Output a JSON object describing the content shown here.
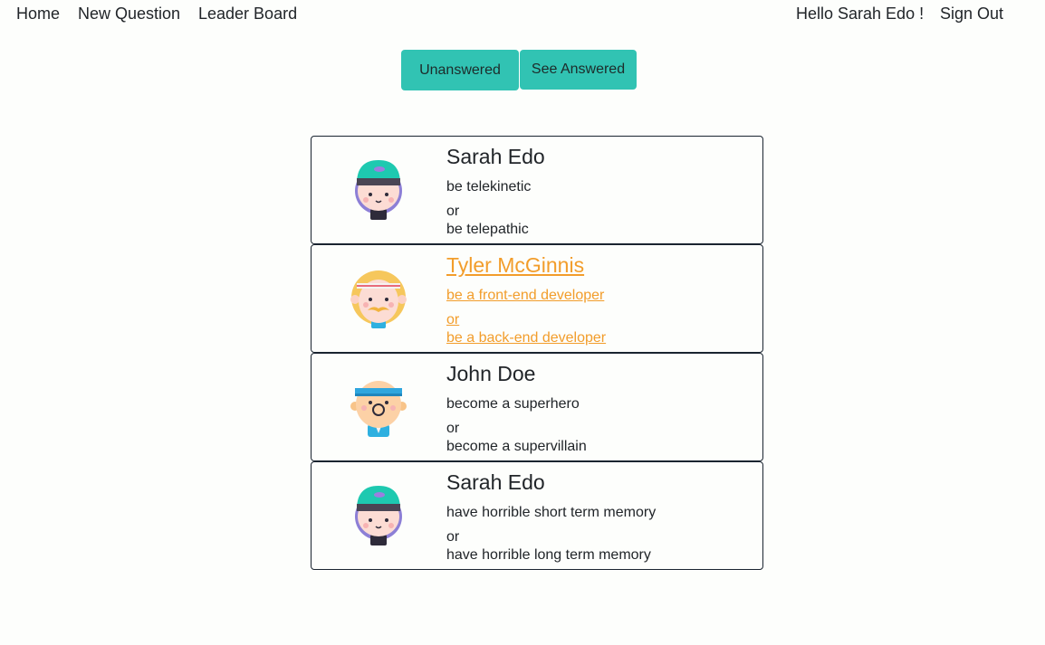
{
  "nav": {
    "home": "Home",
    "new_question": "New Question",
    "leader_board": "Leader Board",
    "greeting": "Hello Sarah Edo !",
    "sign_out": "Sign Out"
  },
  "tabs": {
    "unanswered": "Unanswered",
    "answered": "See Answered"
  },
  "questions": [
    {
      "author": "Sarah Edo",
      "avatar": "sarah-avatar-icon",
      "option_one": "be telekinetic",
      "or": "or",
      "option_two": "be telepathic"
    },
    {
      "author": "Tyler McGinnis",
      "avatar": "tyler-avatar-icon",
      "option_one": "be a front-end developer",
      "or": "or",
      "option_two": "be a back-end developer"
    },
    {
      "author": "John Doe",
      "avatar": "john-avatar-icon",
      "option_one": "become a superhero",
      "or": "or",
      "option_two": "become a supervillain"
    },
    {
      "author": "Sarah Edo",
      "avatar": "sarah-avatar-icon",
      "option_one": "have horrible short term memory",
      "or": "or",
      "option_two": "have horrible long term memory"
    }
  ],
  "colors": {
    "tab_background": "#31c3b3",
    "hover_link": "#f29d2b",
    "card_border": "#1a2430"
  }
}
